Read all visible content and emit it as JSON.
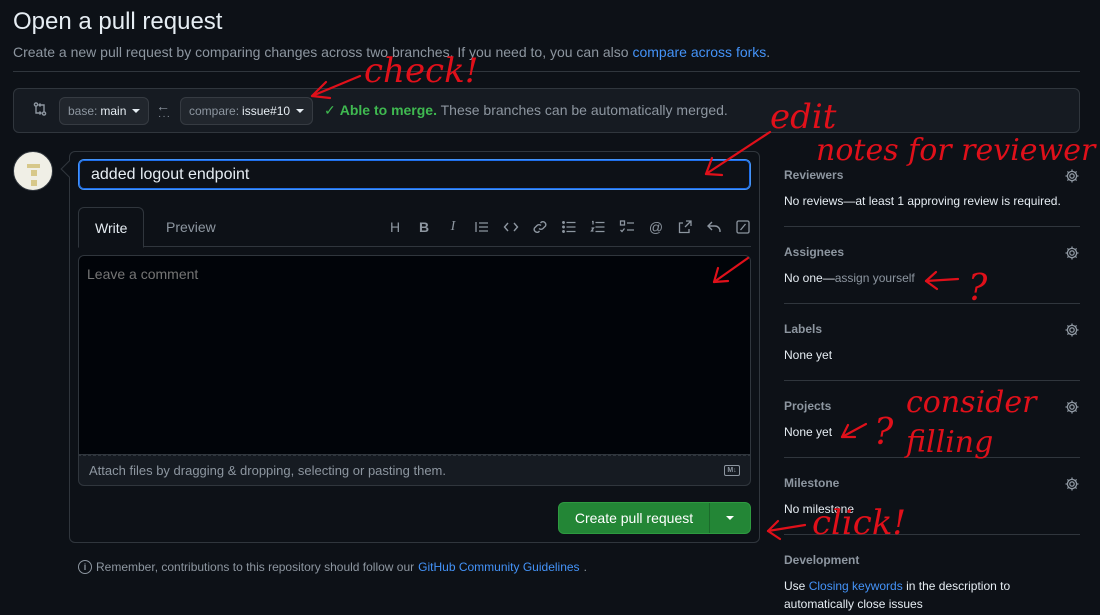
{
  "page": {
    "title": "Open a pull request",
    "subtitle_text": "Create a new pull request by comparing changes across two branches. If you need to, you can also",
    "subtitle_link": "compare across forks",
    "subtitle_end": "."
  },
  "compare": {
    "base_label": "base:",
    "base_value": "main",
    "compare_label": "compare:",
    "compare_value": "issue#10",
    "merge_status_ok": "Able to merge.",
    "merge_status_text": "These branches can be automatically merged."
  },
  "form": {
    "title_value": "added logout endpoint",
    "tabs": [
      "Write",
      "Preview"
    ],
    "comment_placeholder": "Leave a comment",
    "attach_text": "Attach files by dragging & dropping, selecting or pasting them.",
    "markdown_badge": "M↓",
    "create_button": "Create pull request"
  },
  "toolbar_icons": [
    "heading-icon",
    "bold-icon",
    "italic-icon",
    "quote-icon",
    "code-icon",
    "link-icon",
    "unordered-list-icon",
    "ordered-list-icon",
    "task-list-icon",
    "mention-icon",
    "cross-reference-icon",
    "reply-icon",
    "slash-commands-icon"
  ],
  "toolbar_glyphs": {
    "heading": "H",
    "bold": "B",
    "italic": "I",
    "mention": "@"
  },
  "footer": {
    "remember_text": "Remember, contributions to this repository should follow our",
    "remember_link": "GitHub Community Guidelines",
    "remember_end": "."
  },
  "sidebar": {
    "reviewers": {
      "heading": "Reviewers",
      "value": "No reviews—at least 1 approving review is required."
    },
    "assignees": {
      "heading": "Assignees",
      "value_prefix": "No one—",
      "value_link": "assign yourself"
    },
    "labels": {
      "heading": "Labels",
      "value": "None yet"
    },
    "projects": {
      "heading": "Projects",
      "value": "None yet"
    },
    "milestone": {
      "heading": "Milestone",
      "value": "No milestone"
    },
    "development": {
      "heading": "Development",
      "value_prefix": "Use",
      "value_link": "Closing keywords",
      "value_suffix": "in the description to",
      "value_line2": "automatically close issues"
    }
  },
  "annotations": {
    "check": "check!",
    "edit": "edit",
    "notes": "notes for reviewer",
    "question_assign": "?",
    "question_projects": "?",
    "consider": "consider",
    "filling": "filling",
    "click": "click!"
  },
  "colors": {
    "background": "#0d1117",
    "accent_link": "#4493f8",
    "success": "#3fb950",
    "button_green": "#238636",
    "annotation_red": "#e0101a"
  }
}
